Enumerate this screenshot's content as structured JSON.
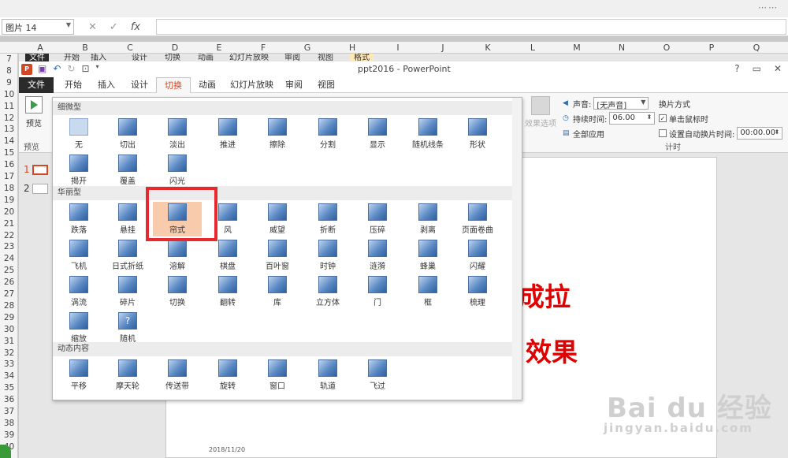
{
  "excel": {
    "name_box": "图片 14",
    "fx_cancel": "✕",
    "fx_enter": "✓",
    "fx_label": "fx",
    "columns": [
      "A",
      "B",
      "C",
      "D",
      "E",
      "F",
      "G",
      "H",
      "I",
      "J",
      "K",
      "L",
      "M",
      "N",
      "O",
      "P",
      "Q"
    ],
    "rows": [
      "7",
      "8",
      "9",
      "10",
      "11",
      "12",
      "13",
      "14",
      "15",
      "16",
      "17",
      "18",
      "19",
      "20",
      "21",
      "22",
      "23",
      "24",
      "25",
      "26",
      "27",
      "28",
      "29",
      "30",
      "31",
      "32",
      "33",
      "34",
      "35",
      "36",
      "37",
      "38",
      "39",
      "40"
    ],
    "top_dots": "⋯⋯"
  },
  "ghost_tabs": [
    "文件",
    "开始",
    "插入",
    "设计",
    "切换",
    "动画",
    "幻灯片放映",
    "审阅",
    "视图",
    "格式"
  ],
  "window": {
    "logo": "P",
    "title": "ppt2016 - PowerPoint",
    "help": "?",
    "restore": "▭",
    "close": "✕"
  },
  "tabs": [
    "文件",
    "开始",
    "插入",
    "设计",
    "切换",
    "动画",
    "幻灯片放映",
    "审阅",
    "视图"
  ],
  "active_tab": "切换",
  "ribbon": {
    "preview_label": "预览",
    "preview_group": "预览",
    "effect_options": "效果选项",
    "sound_label": "声音:",
    "sound_value": "[无声音]",
    "duration_label": "持续时间:",
    "duration_value": "06.00",
    "apply_all": "全部应用",
    "advance_title": "换片方式",
    "on_click": "单击鼠标时",
    "after_time": "设置自动换片时间:",
    "after_value": "00:00.00",
    "timing_group": "计时"
  },
  "thumbs": [
    {
      "num": "1"
    },
    {
      "num": "2"
    }
  ],
  "slide": {
    "line1": "置成拉",
    "line2": "效果",
    "date": "2018/11/20"
  },
  "gallery": {
    "sections": [
      "细微型",
      "华丽型",
      "动态内容"
    ],
    "subtle": [
      "无",
      "切出",
      "淡出",
      "推进",
      "擦除",
      "分割",
      "显示",
      "随机线条",
      "形状",
      "揭开",
      "覆盖",
      "闪光"
    ],
    "exciting": [
      "跌落",
      "悬挂",
      "帘式",
      "风",
      "威望",
      "折断",
      "压碎",
      "剥离",
      "页面卷曲",
      "飞机",
      "日式折纸",
      "溶解",
      "棋盘",
      "百叶窗",
      "时钟",
      "涟漪",
      "蜂巢",
      "闪耀",
      "涡流",
      "碎片",
      "切换",
      "翻转",
      "库",
      "立方体",
      "门",
      "框",
      "梳理",
      "缩放",
      "随机"
    ],
    "dynamic": [
      "平移",
      "摩天轮",
      "传送带",
      "旋转",
      "窗口",
      "轨道",
      "飞过"
    ],
    "selected": "帘式",
    "random_glyph": "?"
  },
  "watermark": {
    "main": "Bai du 经验",
    "url": "jingyan.baidu.com"
  }
}
